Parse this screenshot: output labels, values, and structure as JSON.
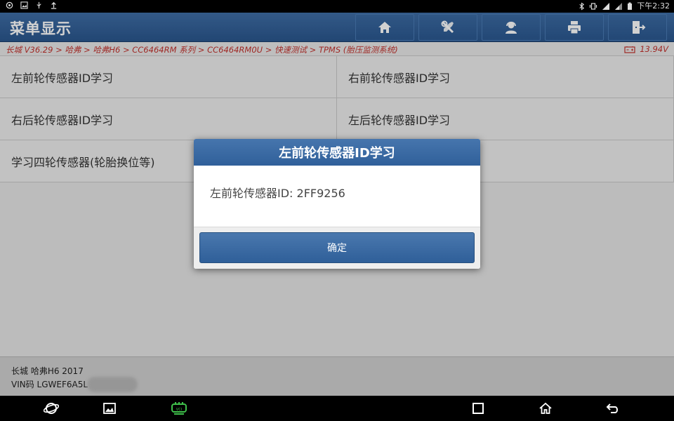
{
  "status_bar": {
    "time": "下午2:32",
    "left_icons": [
      "settings-icon",
      "image-icon",
      "usb-icon",
      "upload-icon"
    ],
    "right_icons": [
      "bluetooth-icon",
      "vibrate-icon",
      "wifi-icon",
      "signal-icon",
      "battery-icon"
    ]
  },
  "header": {
    "title": "菜单显示",
    "buttons": [
      "home-icon",
      "diagnose-icon",
      "support-icon",
      "print-icon",
      "exit-icon"
    ]
  },
  "breadcrumb": {
    "path": "长城 V36.29 > 哈弗 > 哈弗H6 > CC6464RM 系列 > CC6464RM0U > 快速测试 > TPMS (胎压监测系统)",
    "voltage": "13.94V"
  },
  "menu": {
    "items": [
      "左前轮传感器ID学习",
      "右前轮传感器ID学习",
      "右后轮传感器ID学习",
      "左后轮传感器ID学习",
      "学习四轮传感器(轮胎换位等)"
    ]
  },
  "vehicle_info": {
    "name": "长城 哈弗H6 2017",
    "vin": "VIN码 LGWEF6A5L"
  },
  "dialog": {
    "title": "左前轮传感器ID学习",
    "message": "左前轮传感器ID: 2FF9256",
    "ok_label": "确定"
  },
  "colors": {
    "header_blue": "#2f5e98",
    "breadcrumb_red": "#c2312c",
    "dialog_button": "#3a69a3"
  }
}
